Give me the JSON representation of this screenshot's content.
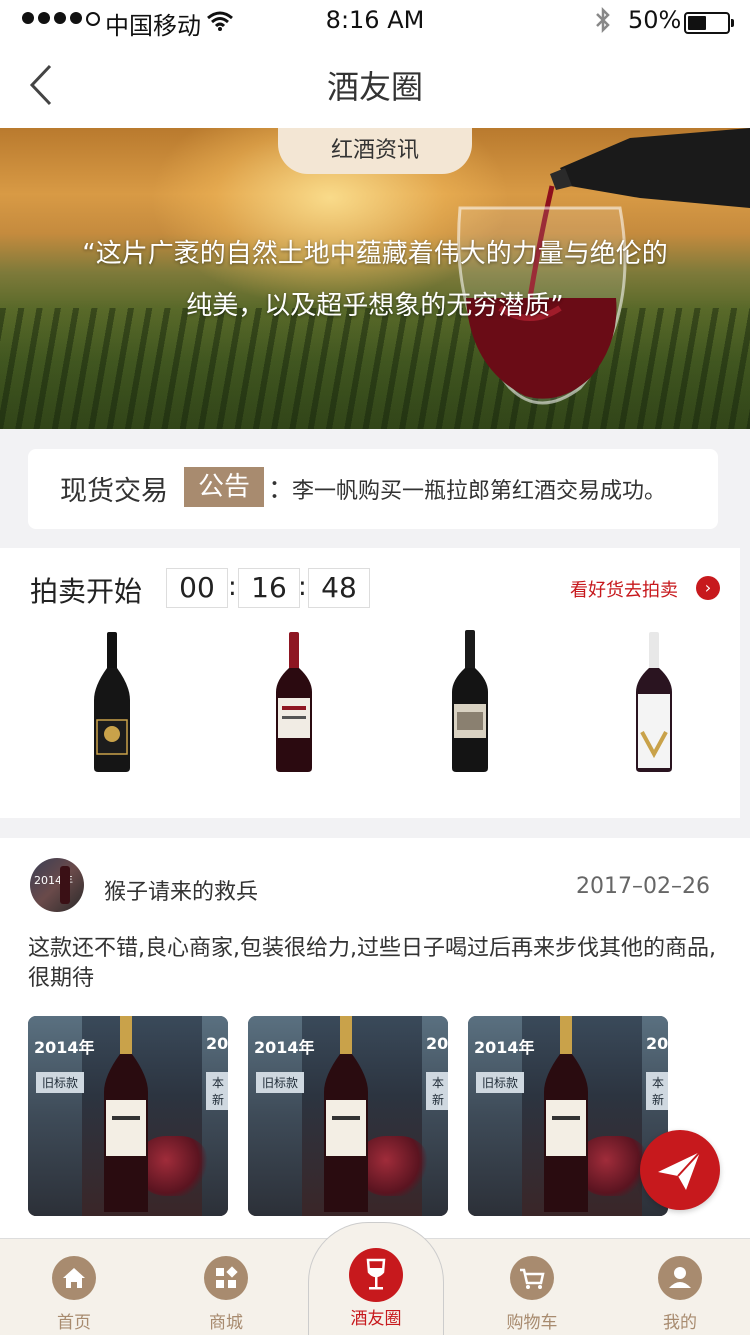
{
  "status_bar": {
    "carrier": "中国移动",
    "time": "8:16 AM",
    "battery": "50%",
    "battery_level": 0.5
  },
  "nav": {
    "title": "酒友圈"
  },
  "banner": {
    "tag": "红酒资讯",
    "quote_line1": "“这片广袤的自然土地中蕴藏着伟大的力量与绝伦的",
    "quote_line2": "纯美，以及超乎想象的无穷潜质”"
  },
  "notice": {
    "label": "现货交易",
    "pill": "公告",
    "colon": "：",
    "message": "李一帆购买一瓶拉郎第红酒交易成功。"
  },
  "auction": {
    "title": "拍卖开始",
    "hours": "00",
    "minutes": "16",
    "seconds": "48",
    "separator": ":",
    "more_link": "看好货去拍卖",
    "more_icon": "chevron-right-icon"
  },
  "review": {
    "user_name": "猴子请来的救兵",
    "date": "2017–02–26",
    "text": "这款还不错,良心商家,包装很给力,过些日子喝过后再来步伐其他的商品,很期待",
    "photo": {
      "year": "2014年",
      "year_cut": "20",
      "old_tag": "旧标款",
      "new_tag": "本新"
    }
  },
  "tabs": [
    {
      "label": "首页",
      "icon": "home-icon"
    },
    {
      "label": "商城",
      "icon": "grid-icon"
    },
    {
      "label": "酒友圈",
      "icon": "wine-glass-icon"
    },
    {
      "label": "购物车",
      "icon": "cart-icon"
    },
    {
      "label": "我的",
      "icon": "user-icon"
    }
  ],
  "colors": {
    "accent": "#c7191d",
    "brand_tan": "#a88b6f",
    "tab_bg": "#f5f1ea"
  }
}
